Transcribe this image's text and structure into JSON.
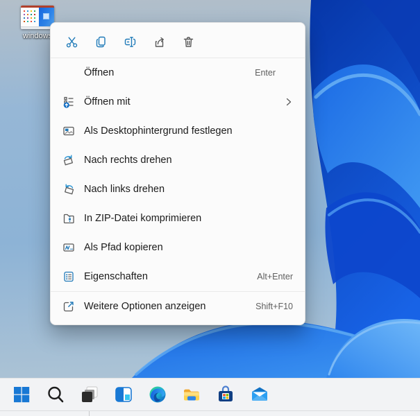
{
  "desktop": {
    "icon_label": "windows",
    "wallpaper_colors": {
      "base_top": "#b3bfc9",
      "base_mid": "#8db3d6",
      "bloom_deep": "#0636a8",
      "bloom_mid": "#1b6ae4",
      "bloom_bright": "#3f97f2",
      "bloom_highlight": "#66aef4"
    }
  },
  "context_menu": {
    "quick_actions": [
      {
        "icon": "cut-icon"
      },
      {
        "icon": "copy-icon"
      },
      {
        "icon": "rename-icon"
      },
      {
        "icon": "share-icon"
      },
      {
        "icon": "delete-icon"
      }
    ],
    "items": [
      {
        "label": "Öffnen",
        "shortcut": "Enter",
        "icon": "none",
        "submenu": false
      },
      {
        "label": "Öffnen mit",
        "shortcut": "",
        "icon": "open-with-icon",
        "submenu": true
      },
      {
        "label": "Als Desktophintergrund festlegen",
        "shortcut": "",
        "icon": "set-wallpaper-icon",
        "submenu": false
      },
      {
        "label": "Nach rechts drehen",
        "shortcut": "",
        "icon": "rotate-right-icon",
        "submenu": false
      },
      {
        "label": "Nach links drehen",
        "shortcut": "",
        "icon": "rotate-left-icon",
        "submenu": false
      },
      {
        "label": "In ZIP-Datei komprimieren",
        "shortcut": "",
        "icon": "compress-zip-icon",
        "submenu": false
      },
      {
        "label": "Als Pfad kopieren",
        "shortcut": "",
        "icon": "copy-path-icon",
        "submenu": false
      },
      {
        "label": "Eigenschaften",
        "shortcut": "Alt+Enter",
        "icon": "properties-icon",
        "submenu": false
      },
      {
        "label": "Weitere Optionen anzeigen",
        "shortcut": "Shift+F10",
        "icon": "more-options-icon",
        "submenu": false
      }
    ],
    "colors": {
      "accent_blue": "#1f7ab8",
      "icon_gray": "#5a5a5a",
      "text": "#1b1b1b",
      "shortcut": "#5f5f5f"
    }
  },
  "taskbar": {
    "items": [
      {
        "icon": "start-icon"
      },
      {
        "icon": "search-icon"
      },
      {
        "icon": "task-view-icon"
      },
      {
        "icon": "widgets-icon"
      },
      {
        "icon": "edge-icon"
      },
      {
        "icon": "file-explorer-icon"
      },
      {
        "icon": "store-icon"
      },
      {
        "icon": "mail-icon"
      }
    ]
  }
}
